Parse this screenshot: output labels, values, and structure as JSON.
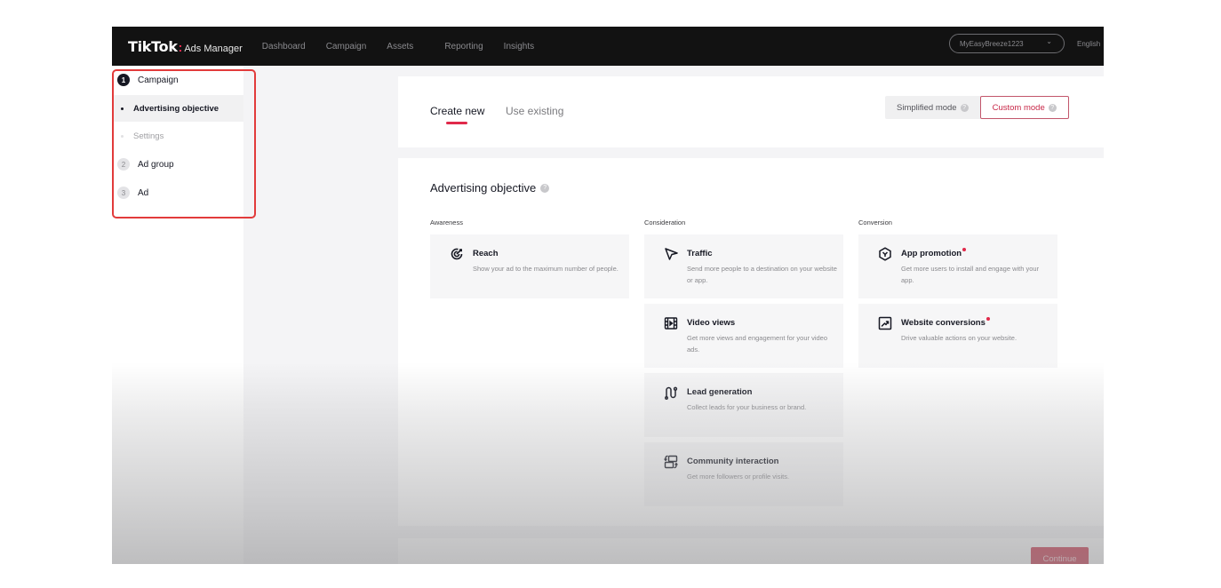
{
  "app": {
    "brand": "TikTok",
    "product": "Ads Manager"
  },
  "nav": {
    "items": [
      {
        "label": "Dashboard"
      },
      {
        "label": "Campaign"
      },
      {
        "label": "Assets"
      },
      {
        "label": "Reporting"
      },
      {
        "label": "Insights"
      }
    ],
    "account": "MyEasyBreeze1223",
    "language": "English"
  },
  "sidebar": {
    "steps": [
      {
        "number": "1",
        "label": "Campaign",
        "state": "active"
      },
      {
        "number": "2",
        "label": "Ad group",
        "state": "idle"
      },
      {
        "number": "3",
        "label": "Ad",
        "state": "idle"
      }
    ],
    "substeps": [
      {
        "label": "Advertising objective",
        "state": "active"
      },
      {
        "label": "Settings",
        "state": "idle"
      }
    ]
  },
  "tabs": {
    "create_new": "Create new",
    "use_existing": "Use existing",
    "active": "Create new"
  },
  "modes": {
    "simplified": "Simplified mode",
    "custom": "Custom mode",
    "active": "Custom mode"
  },
  "objective": {
    "title": "Advertising objective",
    "columns": [
      {
        "label": "Awareness"
      },
      {
        "label": "Consideration"
      },
      {
        "label": "Conversion"
      }
    ],
    "options": {
      "reach": {
        "title": "Reach",
        "desc": "Show your ad to the maximum number of people.",
        "icon": "target-icon"
      },
      "traffic": {
        "title": "Traffic",
        "desc": "Send more people to a destination on your website or app.",
        "icon": "cursor-arrow-icon"
      },
      "video_views": {
        "title": "Video views",
        "desc": "Get more views and engagement for your video ads.",
        "icon": "film-play-icon"
      },
      "lead_generation": {
        "title": "Lead generation",
        "desc": "Collect leads for your business or brand.",
        "icon": "path-node-icon"
      },
      "community_interaction": {
        "title": "Community interaction",
        "desc": "Get more followers or profile visits.",
        "icon": "profile-swap-icon"
      },
      "app_promotion": {
        "title": "App promotion",
        "desc": "Get more users to install and engage with your app.",
        "icon": "app-hexagon-icon",
        "new": true
      },
      "website_conversions": {
        "title": "Website conversions",
        "desc": "Drive valuable actions on your website.",
        "icon": "trend-up-icon",
        "new": true
      }
    }
  },
  "footer": {
    "continue": "Continue"
  },
  "colors": {
    "accent": "#e0294a",
    "continue_button": "#c8263f",
    "topbar": "#121212",
    "highlight_box": "#e23b3b"
  }
}
